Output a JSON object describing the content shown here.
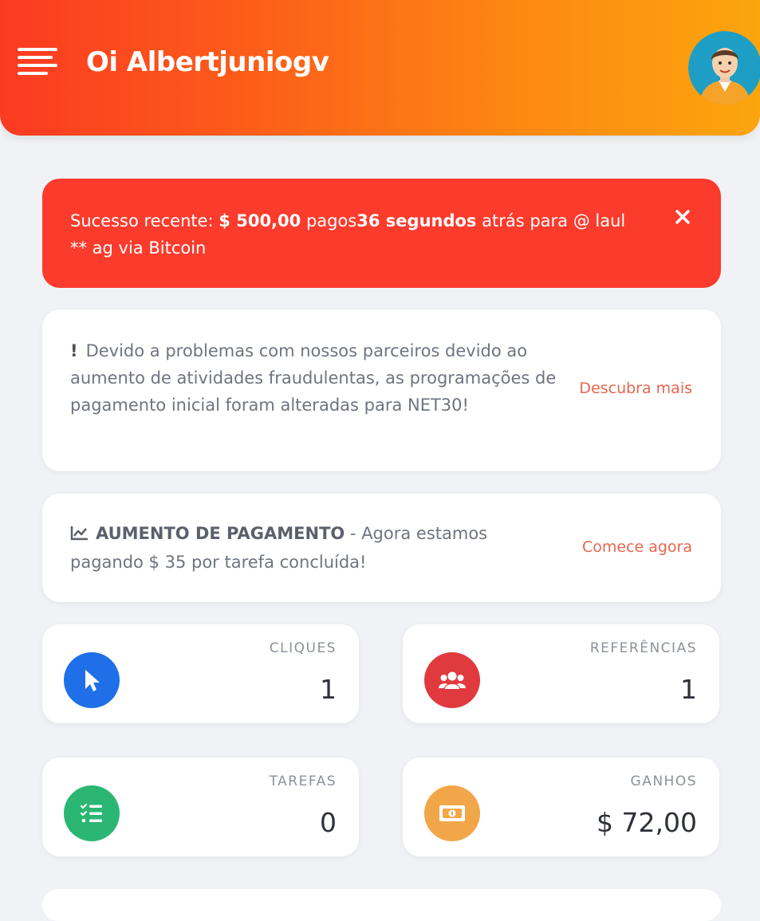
{
  "header": {
    "greeting": "Oi Albertjuniogv",
    "menu_icon": "hamburger-menu-icon",
    "avatar_icon": "user-avatar"
  },
  "alert": {
    "prefix": "Sucesso recente: ",
    "amount": "$ 500,00",
    "paid": " pagos",
    "time": "36 segundos",
    "suffix": " atrás para @ laul ** ag via Bitcoin",
    "close_icon": "close-icon",
    "color": "#fb3b2c"
  },
  "notice": {
    "bang": "!",
    "text": "Devido a problemas com nossos parceiros devido ao aumento de atividades fraudulentas, as programações de pagamento inicial foram alteradas para NET30!",
    "link": "Descubra mais"
  },
  "promo": {
    "icon": "trending-chart-icon",
    "title": "AUMENTO DE PAGAMENTO",
    "text": " - Agora estamos pagando $ 35 por tarefa concluída!",
    "link": "Comece agora"
  },
  "stats": {
    "cliques": {
      "label": "CLIQUES",
      "value": "1",
      "icon": "cursor-icon",
      "color": "#1f6fe8"
    },
    "referencias": {
      "label": "REFERÊNCIAS",
      "value": "1",
      "icon": "users-icon",
      "color": "#e03a3e"
    },
    "tarefas": {
      "label": "TAREFAS",
      "value": "0",
      "icon": "tasks-list-icon",
      "color": "#2bb673"
    },
    "ganhos": {
      "label": "GANHOS",
      "value": "$ 72,00",
      "icon": "money-bill-icon",
      "color": "#f2a64a"
    }
  },
  "colors": {
    "header_gradient_start": "#fb3a22",
    "header_gradient_end": "#fca50d",
    "link": "#e8664f",
    "background": "#f1f2f5"
  }
}
